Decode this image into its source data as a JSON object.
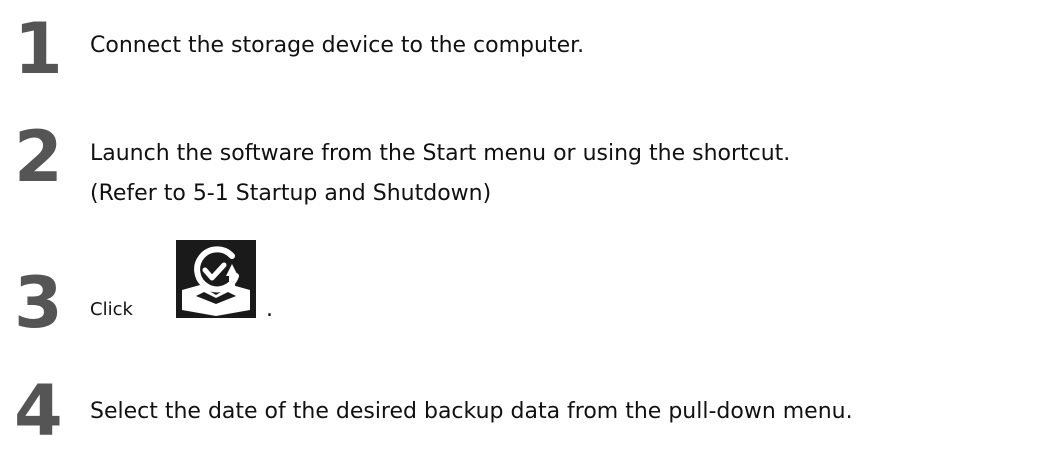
{
  "steps": [
    {
      "number": "1",
      "text": "Connect the storage device to the computer."
    },
    {
      "number": "2",
      "line1": "Launch the software from the Start menu or using the shortcut.",
      "line2": "(Refer to 5-1 Startup and Shutdown)"
    },
    {
      "number": "3",
      "click_label": "Click",
      "after_icon": ".",
      "icon": "backup-restore-icon"
    },
    {
      "number": "4",
      "text": "Select the date of the desired backup data from the pull-down menu."
    }
  ]
}
